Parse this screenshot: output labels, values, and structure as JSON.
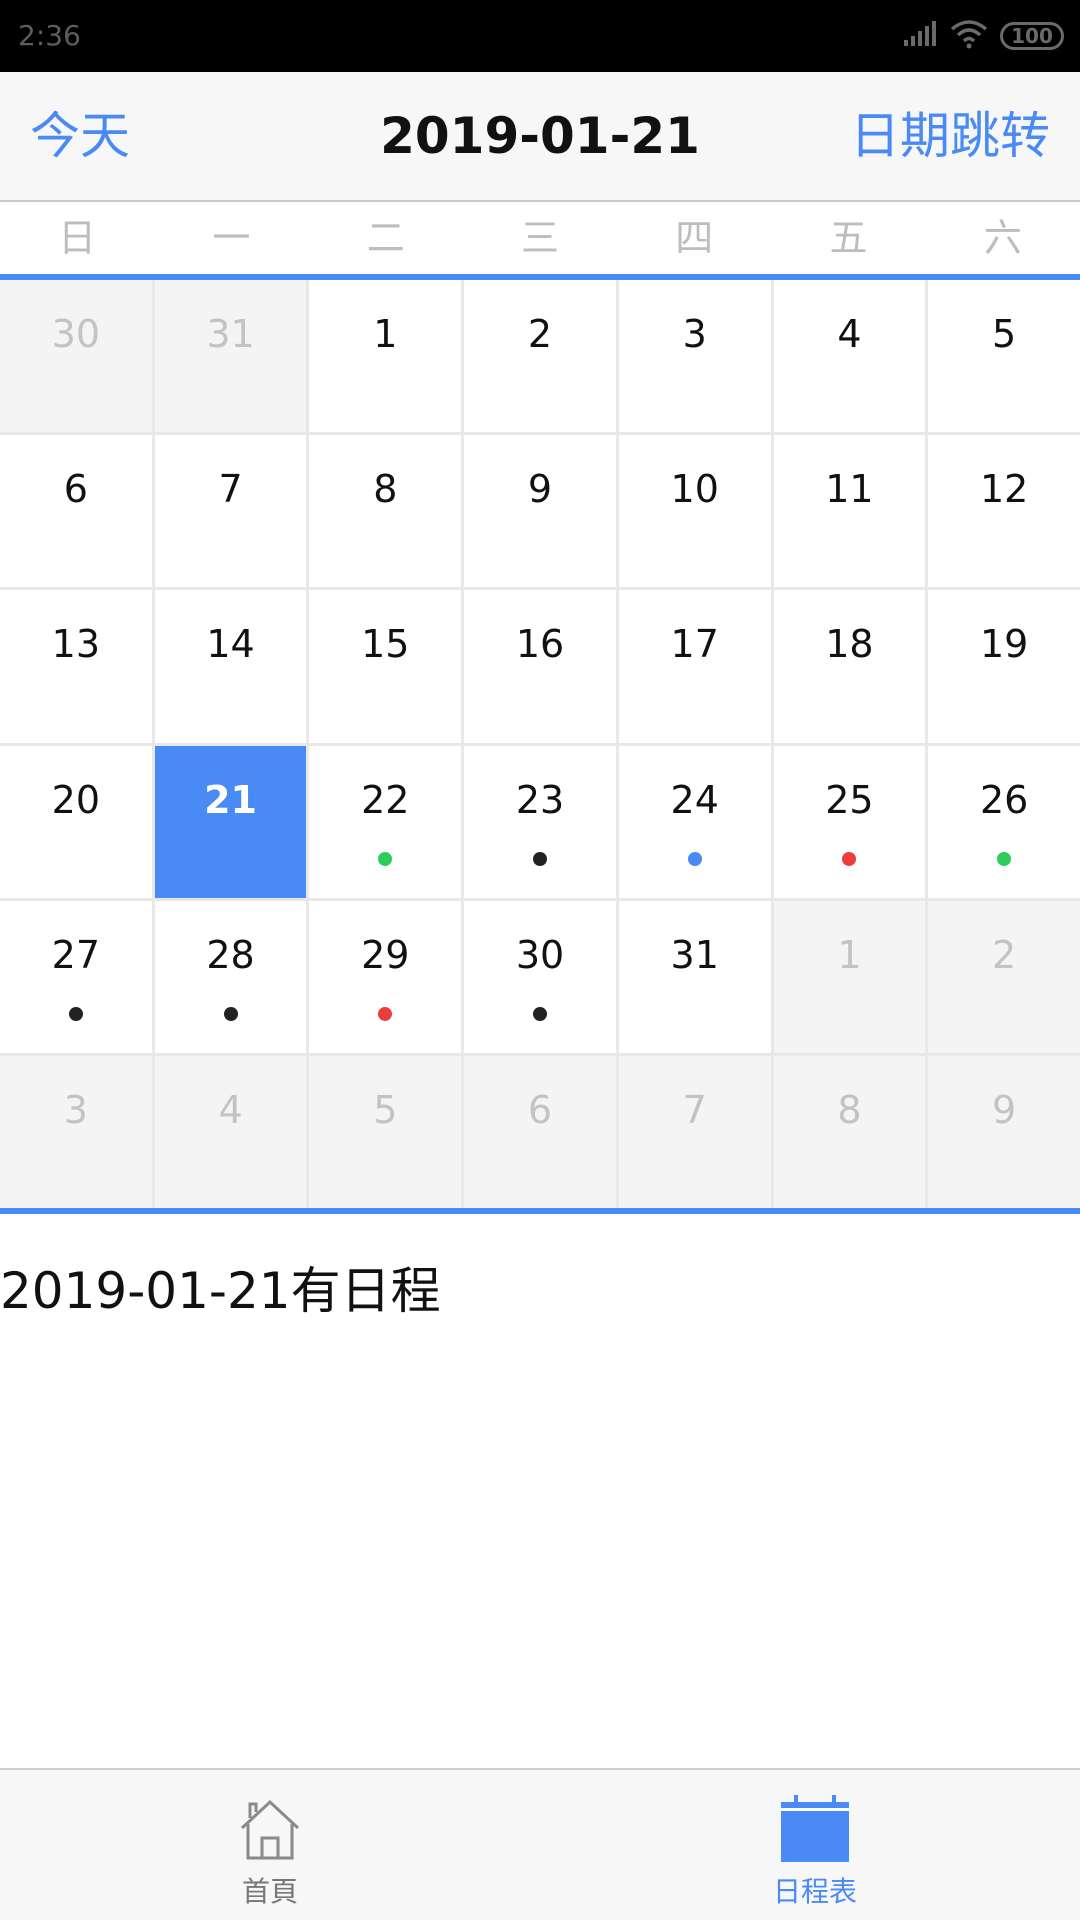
{
  "status_bar": {
    "time": "2:36",
    "battery": "100"
  },
  "header": {
    "today_label": "今天",
    "title": "2019-01-21",
    "jump_label": "日期跳转"
  },
  "weekdays": [
    "日",
    "一",
    "二",
    "三",
    "四",
    "五",
    "六"
  ],
  "calendar": {
    "selected_date": "2019-01-21",
    "days": [
      {
        "day": "30",
        "other": true,
        "selected": false,
        "dot": ""
      },
      {
        "day": "31",
        "other": true,
        "selected": false,
        "dot": ""
      },
      {
        "day": "1",
        "other": false,
        "selected": false,
        "dot": ""
      },
      {
        "day": "2",
        "other": false,
        "selected": false,
        "dot": ""
      },
      {
        "day": "3",
        "other": false,
        "selected": false,
        "dot": ""
      },
      {
        "day": "4",
        "other": false,
        "selected": false,
        "dot": ""
      },
      {
        "day": "5",
        "other": false,
        "selected": false,
        "dot": ""
      },
      {
        "day": "6",
        "other": false,
        "selected": false,
        "dot": ""
      },
      {
        "day": "7",
        "other": false,
        "selected": false,
        "dot": ""
      },
      {
        "day": "8",
        "other": false,
        "selected": false,
        "dot": ""
      },
      {
        "day": "9",
        "other": false,
        "selected": false,
        "dot": ""
      },
      {
        "day": "10",
        "other": false,
        "selected": false,
        "dot": ""
      },
      {
        "day": "11",
        "other": false,
        "selected": false,
        "dot": ""
      },
      {
        "day": "12",
        "other": false,
        "selected": false,
        "dot": ""
      },
      {
        "day": "13",
        "other": false,
        "selected": false,
        "dot": ""
      },
      {
        "day": "14",
        "other": false,
        "selected": false,
        "dot": ""
      },
      {
        "day": "15",
        "other": false,
        "selected": false,
        "dot": ""
      },
      {
        "day": "16",
        "other": false,
        "selected": false,
        "dot": ""
      },
      {
        "day": "17",
        "other": false,
        "selected": false,
        "dot": ""
      },
      {
        "day": "18",
        "other": false,
        "selected": false,
        "dot": ""
      },
      {
        "day": "19",
        "other": false,
        "selected": false,
        "dot": ""
      },
      {
        "day": "20",
        "other": false,
        "selected": false,
        "dot": ""
      },
      {
        "day": "21",
        "other": false,
        "selected": true,
        "dot": ""
      },
      {
        "day": "22",
        "other": false,
        "selected": false,
        "dot": "#2ecc5a"
      },
      {
        "day": "23",
        "other": false,
        "selected": false,
        "dot": "#222222"
      },
      {
        "day": "24",
        "other": false,
        "selected": false,
        "dot": "#4a8af4"
      },
      {
        "day": "25",
        "other": false,
        "selected": false,
        "dot": "#ee3b3b"
      },
      {
        "day": "26",
        "other": false,
        "selected": false,
        "dot": "#2ecc5a"
      },
      {
        "day": "27",
        "other": false,
        "selected": false,
        "dot": "#222222"
      },
      {
        "day": "28",
        "other": false,
        "selected": false,
        "dot": "#222222"
      },
      {
        "day": "29",
        "other": false,
        "selected": false,
        "dot": "#ee3b3b"
      },
      {
        "day": "30",
        "other": false,
        "selected": false,
        "dot": "#222222"
      },
      {
        "day": "31",
        "other": false,
        "selected": false,
        "dot": ""
      },
      {
        "day": "1",
        "other": true,
        "selected": false,
        "dot": ""
      },
      {
        "day": "2",
        "other": true,
        "selected": false,
        "dot": ""
      },
      {
        "day": "3",
        "other": true,
        "selected": false,
        "dot": ""
      },
      {
        "day": "4",
        "other": true,
        "selected": false,
        "dot": ""
      },
      {
        "day": "5",
        "other": true,
        "selected": false,
        "dot": ""
      },
      {
        "day": "6",
        "other": true,
        "selected": false,
        "dot": ""
      },
      {
        "day": "7",
        "other": true,
        "selected": false,
        "dot": ""
      },
      {
        "day": "8",
        "other": true,
        "selected": false,
        "dot": ""
      },
      {
        "day": "9",
        "other": true,
        "selected": false,
        "dot": ""
      }
    ]
  },
  "schedule": {
    "text": "2019-01-21有日程"
  },
  "bottom_nav": {
    "home_label": "首頁",
    "home_icon": "home-icon",
    "schedule_label": "日程表",
    "schedule_icon": "calendar-icon",
    "active": "schedule"
  },
  "colors": {
    "accent": "#4a8af4",
    "dot_green": "#2ecc5a",
    "dot_black": "#222222",
    "dot_blue": "#4a8af4",
    "dot_red": "#ee3b3b"
  }
}
